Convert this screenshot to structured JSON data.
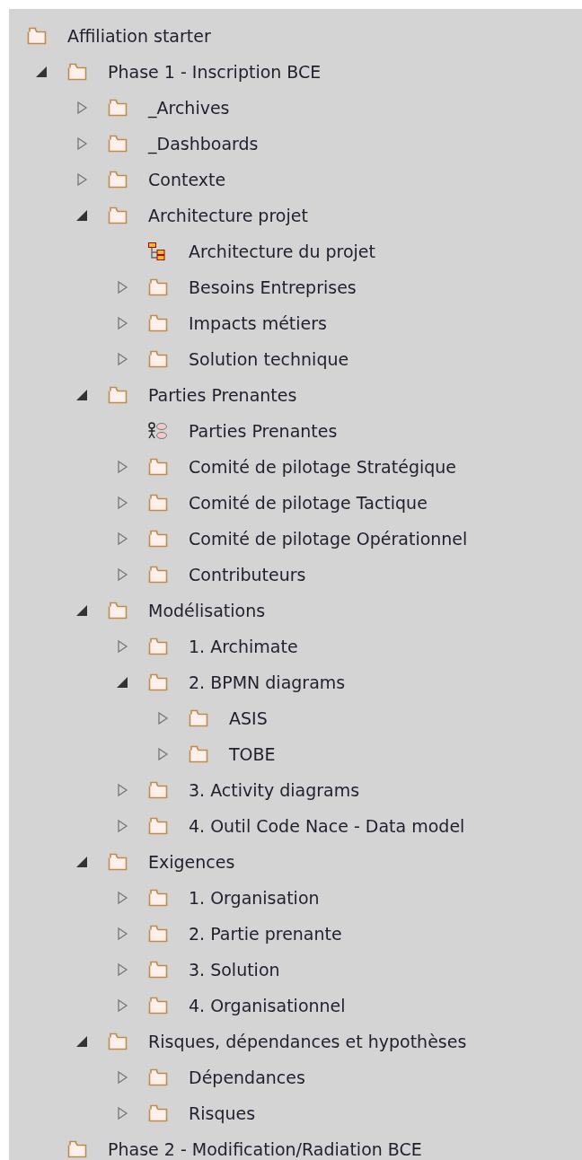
{
  "tree": [
    {
      "label": "Affiliation starter",
      "kind": "folder",
      "children": [
        {
          "label": "Phase 1 - Inscription BCE",
          "kind": "folder",
          "expanded": true,
          "children": [
            {
              "label": "_Archives",
              "kind": "folder",
              "expanded": false
            },
            {
              "label": "_Dashboards",
              "kind": "folder",
              "expanded": false
            },
            {
              "label": "Contexte",
              "kind": "folder",
              "expanded": false
            },
            {
              "label": "Architecture projet",
              "kind": "folder",
              "expanded": true,
              "children": [
                {
                  "label": "Architecture du projet",
                  "kind": "hierarchy"
                },
                {
                  "label": "Besoins Entreprises",
                  "kind": "folder",
                  "expanded": false
                },
                {
                  "label": "Impacts métiers",
                  "kind": "folder",
                  "expanded": false
                },
                {
                  "label": "Solution technique",
                  "kind": "folder",
                  "expanded": false
                }
              ]
            },
            {
              "label": "Parties Prenantes",
              "kind": "folder",
              "expanded": true,
              "children": [
                {
                  "label": "Parties Prenantes",
                  "kind": "usecase"
                },
                {
                  "label": "Comité de pilotage Stratégique",
                  "kind": "folder",
                  "expanded": false
                },
                {
                  "label": "Comité de pilotage Tactique",
                  "kind": "folder",
                  "expanded": false
                },
                {
                  "label": "Comité de pilotage Opérationnel",
                  "kind": "folder",
                  "expanded": false
                },
                {
                  "label": "Contributeurs",
                  "kind": "folder",
                  "expanded": false
                }
              ]
            },
            {
              "label": "Modélisations",
              "kind": "folder",
              "expanded": true,
              "children": [
                {
                  "label": "1. Archimate",
                  "kind": "folder",
                  "expanded": false
                },
                {
                  "label": "2. BPMN diagrams",
                  "kind": "folder",
                  "expanded": true,
                  "children": [
                    {
                      "label": "ASIS",
                      "kind": "folder",
                      "expanded": false
                    },
                    {
                      "label": "TOBE",
                      "kind": "folder",
                      "expanded": false
                    }
                  ]
                },
                {
                  "label": "3. Activity diagrams",
                  "kind": "folder",
                  "expanded": false
                },
                {
                  "label": "4. Outil Code Nace - Data model",
                  "kind": "folder",
                  "expanded": false
                }
              ]
            },
            {
              "label": "Exigences",
              "kind": "folder",
              "expanded": true,
              "children": [
                {
                  "label": "1. Organisation",
                  "kind": "folder",
                  "expanded": false
                },
                {
                  "label": "2. Partie prenante",
                  "kind": "folder",
                  "expanded": false
                },
                {
                  "label": "3. Solution",
                  "kind": "folder",
                  "expanded": false
                },
                {
                  "label": "4. Organisationnel",
                  "kind": "folder",
                  "expanded": false
                }
              ]
            },
            {
              "label": "Risques, dépendances et hypothèses",
              "kind": "folder",
              "expanded": true,
              "children": [
                {
                  "label": "Dépendances",
                  "kind": "folder",
                  "expanded": false
                },
                {
                  "label": "Risques",
                  "kind": "folder",
                  "expanded": false
                }
              ]
            }
          ]
        },
        {
          "label": "Phase 2 - Modification/Radiation BCE",
          "kind": "folder"
        }
      ]
    }
  ]
}
